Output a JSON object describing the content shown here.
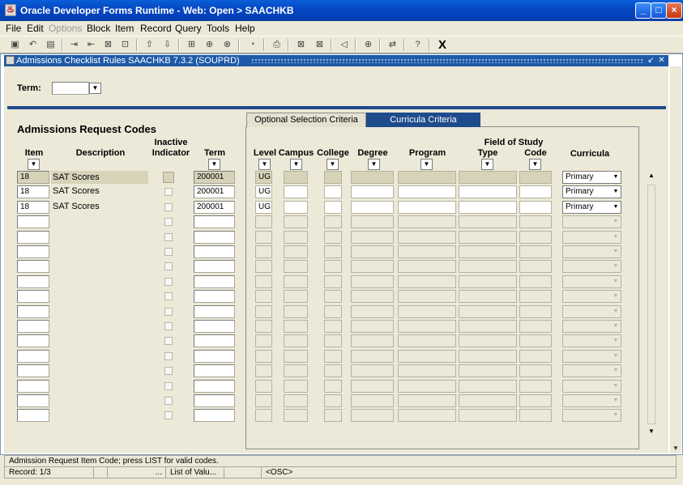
{
  "window": {
    "title": "Oracle Developer Forms Runtime - Web:  Open > SAACHKB",
    "minimize": "_",
    "maximize": "□",
    "close": "×"
  },
  "menu": [
    "File",
    "Edit",
    "Options",
    "Block",
    "Item",
    "Record",
    "Query",
    "Tools",
    "Help"
  ],
  "toolbar": {
    "icons": [
      "save-icon",
      "rollback-icon",
      "print-icon",
      "insert-record-icon",
      "remove-record-icon",
      "clear-record-icon",
      "lock-record-icon",
      "next-block-icon",
      "previous-block-icon",
      "enter-query-icon",
      "execute-query-icon",
      "cancel-query-icon",
      "clear-form-icon",
      "print-form-icon",
      "extract-icon",
      "export-icon",
      "previous-record-icon",
      "navigate-icon",
      "options-icon",
      "help-icon"
    ],
    "exit_label": "X"
  },
  "form": {
    "title": "Admissions Checklist Rules  SAACHKB  7.3.2  (SOUPRD)",
    "term_label": "Term:",
    "term_value": "",
    "section_title": "Admissions Request Codes",
    "columns": {
      "item": "Item",
      "description": "Description",
      "inactive_line1": "Inactive",
      "inactive_line2": "Indicator",
      "term": "Term"
    }
  },
  "tabs": {
    "optional": "Optional Selection Criteria",
    "curricula": "Curricula Criteria"
  },
  "curricula_columns": {
    "level": "Level",
    "campus": "Campus",
    "college": "College",
    "degree": "Degree",
    "program": "Program",
    "field_of_study": "Field of Study",
    "type": "Type",
    "code": "Code",
    "curricula": "Curricula"
  },
  "rows": [
    {
      "item": "18",
      "description": "SAT Scores",
      "term": "200001",
      "level": "UG",
      "curricula": "Primary"
    },
    {
      "item": "18",
      "description": "SAT Scores",
      "term": "200001",
      "level": "UG",
      "curricula": "Primary"
    },
    {
      "item": "18",
      "description": "SAT Scores",
      "term": "200001",
      "level": "UG",
      "curricula": "Primary"
    }
  ],
  "empty_row_count": 14,
  "status": {
    "message": "Admission Request Item Code; press LIST for valid codes.",
    "record": "Record: 1/3",
    "seg2": "",
    "seg3": "...",
    "seg4": "List of Valu...",
    "seg5": "",
    "seg6": "<OSC>"
  },
  "colors": {
    "accent": "#1e4b8c",
    "current_record": "#d6d3b9",
    "titlebar": "#0548c4"
  }
}
